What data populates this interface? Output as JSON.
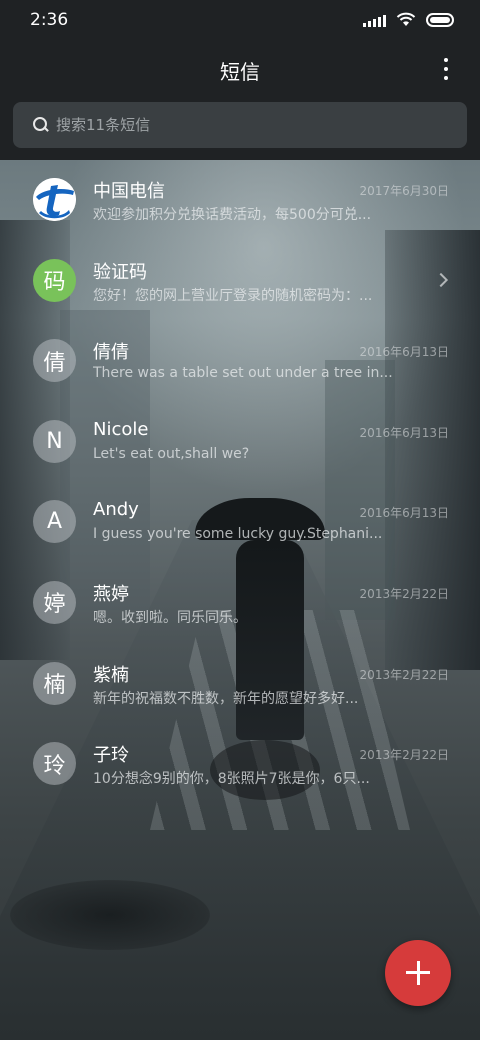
{
  "status_bar": {
    "time": "2:36",
    "icons": [
      "signal-icon",
      "wifi-icon",
      "battery-icon"
    ]
  },
  "header": {
    "title": "短信",
    "menu_icon": "more-vertical-icon"
  },
  "search": {
    "placeholder": "搜索11条短信",
    "icon": "search-icon"
  },
  "conversations": [
    {
      "name": "中国电信",
      "preview": "欢迎参加积分兑换话费活动，每500分可兑...",
      "date": "2017年6月30日",
      "avatar": "telecom-logo"
    },
    {
      "name": "验证码",
      "preview": "您好！您的网上营业厅登录的随机密码为：...",
      "date": "",
      "avatar": "码",
      "has_chevron": true
    },
    {
      "name": "倩倩",
      "preview": "There was a table set out under a tree in...",
      "date": "2016年6月13日",
      "avatar": "倩"
    },
    {
      "name": "Nicole",
      "preview": "Let's eat out,shall we?",
      "date": "2016年6月13日",
      "avatar": "N"
    },
    {
      "name": "Andy",
      "preview": "I guess you're some lucky guy.Stephani...",
      "date": "2016年6月13日",
      "avatar": "A"
    },
    {
      "name": "燕婷",
      "preview": "嗯。收到啦。同乐同乐。",
      "date": "2013年2月22日",
      "avatar": "婷"
    },
    {
      "name": "紫楠",
      "preview": "新年的祝福数不胜数，新年的愿望好多好...",
      "date": "2013年2月22日",
      "avatar": "楠"
    },
    {
      "name": "子玲",
      "preview": "10分想念9别的你，8张照片7张是你，6只...",
      "date": "2013年2月22日",
      "avatar": "玲"
    }
  ],
  "fab": {
    "icon": "plus-icon"
  },
  "colors": {
    "accent": "#d63b3b",
    "header_bg": "#1f2224",
    "avatar_green": "#79c25a",
    "telecom_blue": "#1565c0"
  }
}
